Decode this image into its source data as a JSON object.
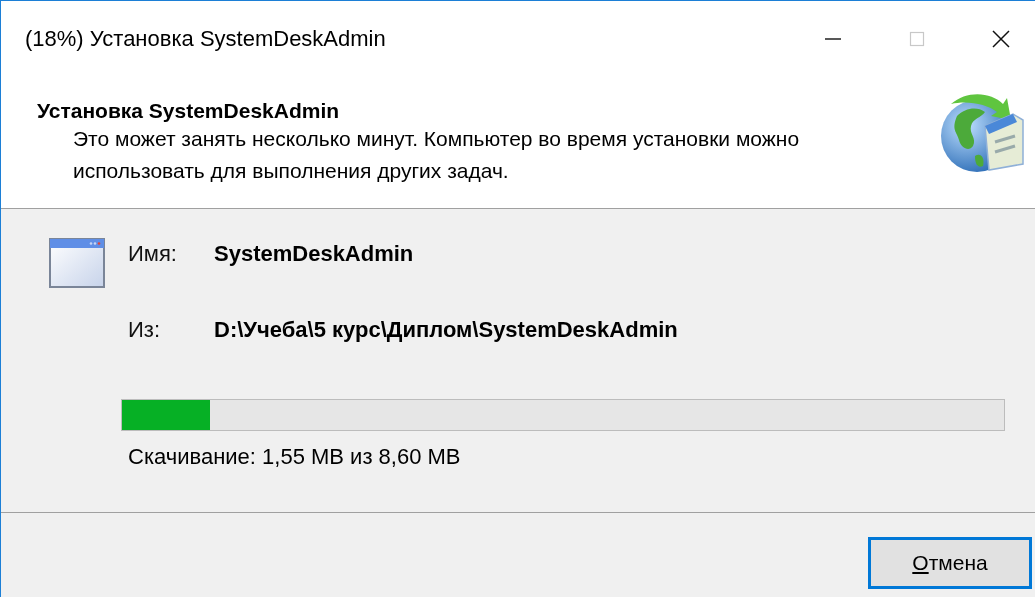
{
  "window": {
    "title": "(18%) Установка SystemDeskAdmin",
    "controls": [
      {
        "kind": "minimize",
        "disabled": false
      },
      {
        "kind": "maximize",
        "disabled": true
      },
      {
        "kind": "close",
        "disabled": false
      }
    ]
  },
  "header": {
    "title": "Установка SystemDeskAdmin",
    "description": "Это может занять несколько минут. Компьютер во время установки можно использовать для выполнения других задач."
  },
  "details": [
    {
      "label": "Имя:",
      "value": "SystemDeskAdmin"
    },
    {
      "label": "Из:",
      "value": "D:\\Учеба\\5 курс\\Диплом\\SystemDeskAdmin"
    }
  ],
  "progress": {
    "level": 0.1,
    "status": "Скачивание: 1,55 MB из 8,60 MB"
  },
  "buttons": [
    {
      "label": "Отмена",
      "access_key_underlined": true
    }
  ]
}
